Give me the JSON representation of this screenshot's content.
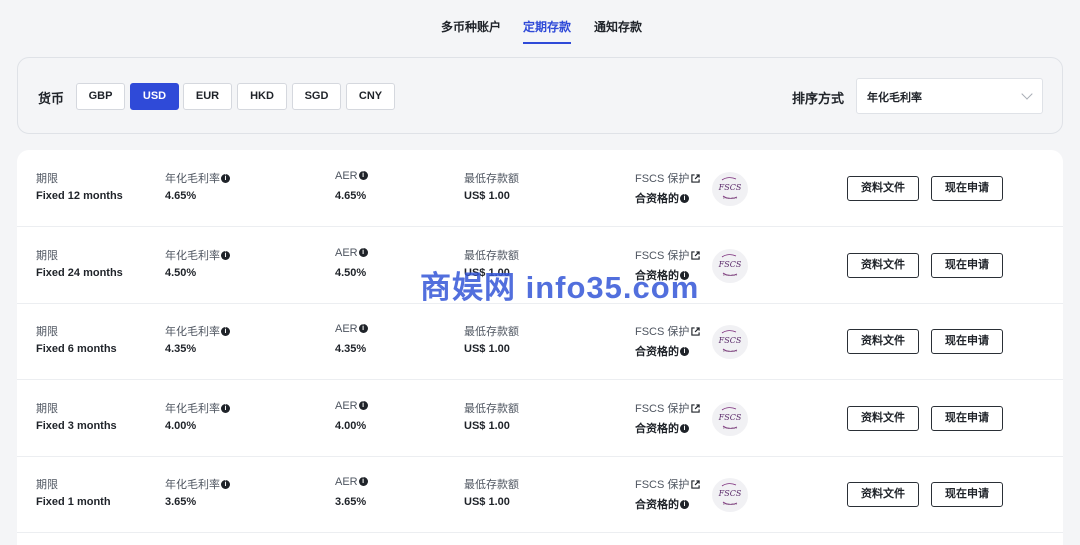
{
  "tabs": [
    {
      "label": "多币种账户",
      "active": false
    },
    {
      "label": "定期存款",
      "active": true
    },
    {
      "label": "通知存款",
      "active": false
    }
  ],
  "filters": {
    "currency_label": "货币",
    "currencies": [
      {
        "code": "GBP",
        "active": false
      },
      {
        "code": "USD",
        "active": true
      },
      {
        "code": "EUR",
        "active": false
      },
      {
        "code": "HKD",
        "active": false
      },
      {
        "code": "SGD",
        "active": false
      },
      {
        "code": "CNY",
        "active": false
      }
    ],
    "sort_label": "排序方式",
    "sort_value": "年化毛利率"
  },
  "columns": {
    "term": "期限",
    "gross_rate": "年化毛利率",
    "aer": "AER",
    "min_deposit": "最低存款额",
    "fscs": "FSCS 保护",
    "fscs_value": "合资格的"
  },
  "buttons": {
    "docs": "资料文件",
    "apply": "现在申请"
  },
  "products": [
    {
      "term": "Fixed 12 months",
      "gross_rate": "4.65%",
      "aer": "4.65%",
      "min_deposit": "US$ 1.00"
    },
    {
      "term": "Fixed 24 months",
      "gross_rate": "4.50%",
      "aer": "4.50%",
      "min_deposit": "US$ 1.00"
    },
    {
      "term": "Fixed 6 months",
      "gross_rate": "4.35%",
      "aer": "4.35%",
      "min_deposit": "US$ 1.00"
    },
    {
      "term": "Fixed 3 months",
      "gross_rate": "4.00%",
      "aer": "4.00%",
      "min_deposit": "US$ 1.00"
    },
    {
      "term": "Fixed 1 month",
      "gross_rate": "3.65%",
      "aer": "3.65%",
      "min_deposit": "US$ 1.00"
    }
  ],
  "fscs_logo": {
    "text": "FSCS",
    "subtext": "Protected"
  },
  "icons": {
    "info": "info-icon",
    "external": "external-link-icon",
    "dropdown": "chevron-down-icon"
  },
  "watermark": "商娱网 info35.com",
  "colors": {
    "accent": "#2f4ad8",
    "background": "#f4f5f7",
    "card": "#ffffff"
  }
}
